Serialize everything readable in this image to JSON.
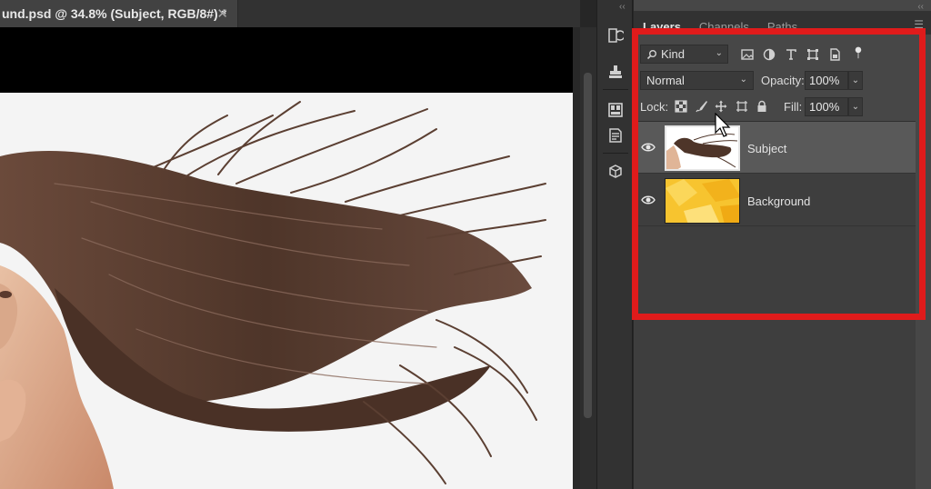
{
  "document": {
    "tab_title": "und.psd @ 34.8% (Subject, RGB/8#) *",
    "close_glyph": "✕"
  },
  "panel": {
    "tabs": [
      {
        "label": "Layers",
        "active": true
      },
      {
        "label": "Channels",
        "active": false
      },
      {
        "label": "Paths",
        "active": false
      }
    ],
    "filter": {
      "kind_label": "Kind",
      "icon_names": [
        "image-filter-icon",
        "adjustment-filter-icon",
        "type-filter-icon",
        "shape-filter-icon",
        "smart-object-filter-icon",
        "filter-toggle-icon"
      ]
    },
    "blend_mode": "Normal",
    "opacity_label": "Opacity:",
    "opacity_value": "100%",
    "lock_label": "Lock:",
    "fill_label": "Fill:",
    "fill_value": "100%",
    "layers": [
      {
        "name": "Subject",
        "selected": true,
        "visible": true
      },
      {
        "name": "Background",
        "selected": false,
        "visible": true
      }
    ]
  },
  "colors": {
    "highlight": "#e01b1b",
    "background_layer": "#f7c42f",
    "hair": "#5a3f33"
  },
  "toolstrip": {
    "icons": [
      "history-icon",
      "clone-source-icon",
      "properties-icon",
      "notes-icon",
      "3d-icon"
    ]
  }
}
